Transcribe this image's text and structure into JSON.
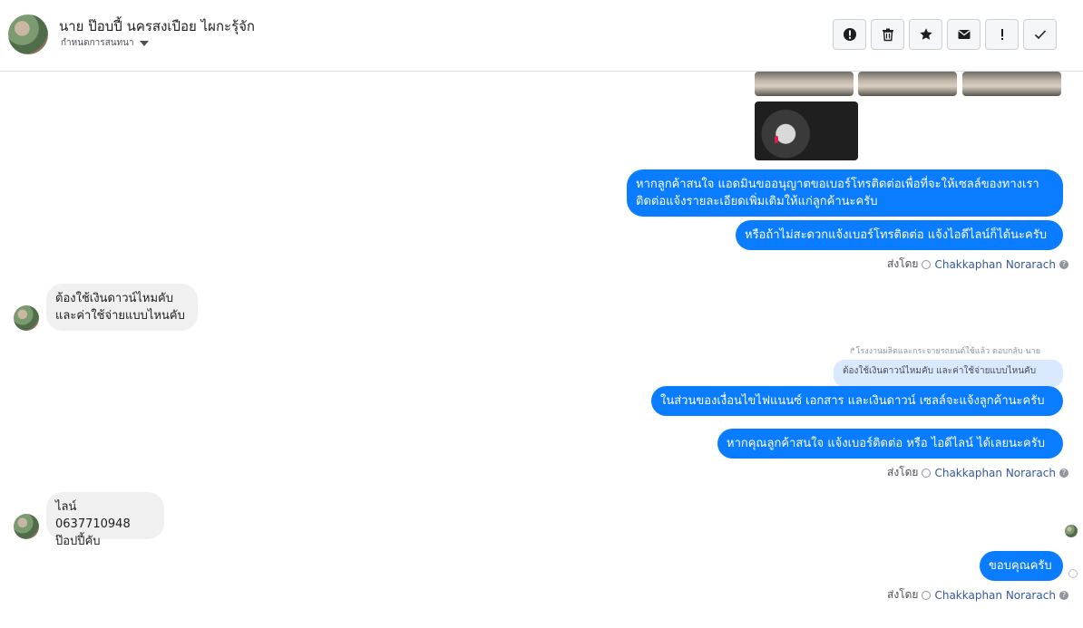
{
  "header": {
    "name": "นาย ป๊อบปี้ นครสงเปือย ไผกะรุ้จัก",
    "subtitle": "กำหนดการสนทนา"
  },
  "toolbar": {
    "buttons": [
      "report-icon",
      "trash-icon",
      "star-icon",
      "mail-icon",
      "important-icon",
      "check-icon"
    ]
  },
  "messages": {
    "m1": "หากลูกค้าสนใจ แอดมินขออนุญาตขอเบอร์โทรติดต่อเพื่อที่จะให้เซลล์ของทางเรา ติดต่อแจ้งรายละเอียดเพิ่มเติมให้แก่ลูกค้านะครับ",
    "m2": "หรือถ้าไม่สะดวกแจ้งเบอร์โทรติดต่อ แจ้งไอดีไลน์ก็ได้นะครับ",
    "in1_line1": "ต้องใช้เงินดาวน์ไหมคับ",
    "in1_line2": "และค่าใช้จ่ายแบบไหนคับ",
    "reply_label": "โรงงานผลิตและกระจายรถยนต์ใช้แล้ว ตอบกลับ นาย",
    "quote": "ต้องใช้เงินดาวน์ไหมคับ และค่าใช้จ่ายแบบไหนคับ",
    "m3": "ในส่วนของเงื่อนไขไฟแนนซ์ เอกสาร และเงินดาวน์ เซลล์จะแจ้งลูกค้านะครับ",
    "m4": "หากคุณลูกค้าสนใจ แจ้งเบอร์ติดต่อ หรือ ไอดีไลน์ ได้เลยนะครับ",
    "in2_line1": "ไลน์ 0637710948",
    "in2_line2": "ป๊อปปี้คับ",
    "m5": "ขอบคุณครับ"
  },
  "sent_by": {
    "label": "ส่งโดย",
    "name": "Chakkaphan Norarach"
  }
}
